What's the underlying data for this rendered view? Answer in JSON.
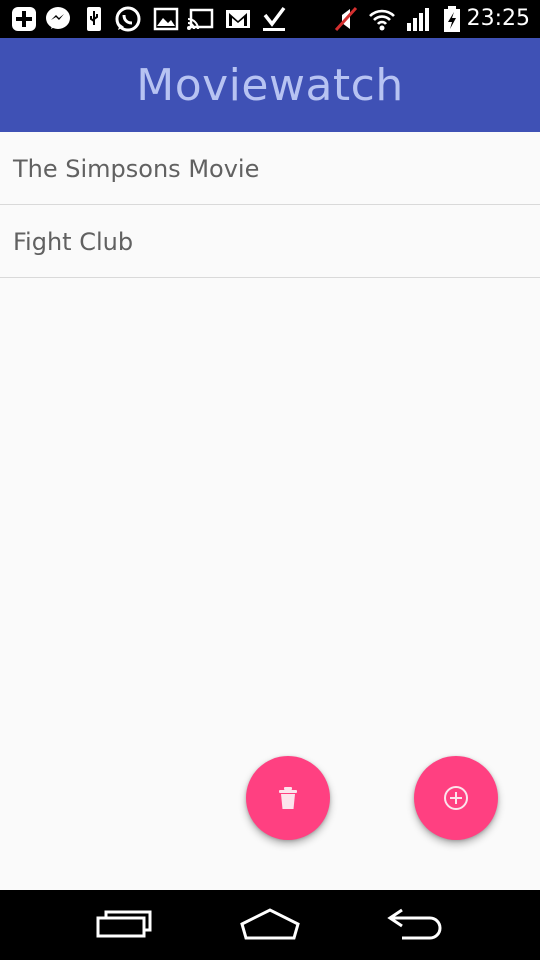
{
  "app": {
    "title": "Moviewatch"
  },
  "status_bar": {
    "time": "23:25",
    "icons": [
      "add-box-icon",
      "messenger-icon",
      "usb-icon",
      "whatsapp-icon",
      "image-icon",
      "cast-icon",
      "gmail-icon",
      "download-done-icon",
      "mute-icon",
      "wifi-icon",
      "signal-icon",
      "battery-charging-icon"
    ]
  },
  "movies": [
    {
      "title": "The Simpsons Movie"
    },
    {
      "title": "Fight Club"
    }
  ],
  "fabs": {
    "delete_icon": "trash-icon",
    "add_icon": "add-circle-icon"
  },
  "colors": {
    "app_bar": "#3f51b5",
    "title": "#b7c3f2",
    "fab": "#ff4081"
  },
  "nav": {
    "icons": [
      "recent-apps-icon",
      "home-icon",
      "back-icon"
    ]
  }
}
